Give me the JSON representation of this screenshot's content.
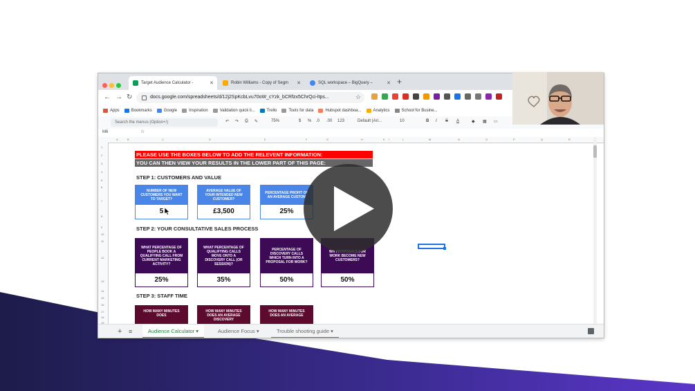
{
  "browser": {
    "tabs": [
      {
        "title": "Target Audience Calculator - ",
        "close": "✕"
      },
      {
        "title": "Robin Williams - Copy of Segm",
        "close": "✕"
      },
      {
        "title": "SQL workspace – BigQuery – ",
        "close": "✕"
      }
    ],
    "new_tab": "+",
    "url": "docs.google.com/spreadsheets/d/12j2SpKcbLvu70oW_cYzk_bCRfzx5ChrQci-ltps...",
    "bookmarks": [
      "Apps",
      "Bookmarks",
      "Google",
      "Inspiration",
      "Validation quick li...",
      "Trello",
      "Tools for data",
      "Hubspot dashboa...",
      "Analytics",
      "School for Busine..."
    ]
  },
  "toolbar": {
    "search_placeholder": "Search the menus (Option+/)",
    "zoom": "75%",
    "currency": "$",
    "percent": "%",
    "dec_dec": ".0",
    "dec_inc": ".00",
    "number_format": "123",
    "font": "Default (Ari...",
    "font_size": "10",
    "bold": "B",
    "italic": "I",
    "strike": "S",
    "text_color": "A"
  },
  "formula_bar": {
    "cell_ref": "M6",
    "fx": "fx"
  },
  "columns": [
    "A",
    "B",
    "C",
    "D",
    "E",
    "F",
    "G",
    "H",
    "I",
    "J",
    "K",
    "L",
    "M",
    "N",
    "O",
    "P",
    "Q",
    "R"
  ],
  "rows": [
    "1",
    "2",
    "3",
    "4",
    "5",
    "6",
    "7",
    "8",
    "9",
    "10",
    "11",
    "12",
    "13",
    "14",
    "15",
    "16",
    "17",
    "18",
    "19",
    "20"
  ],
  "sheet": {
    "banner1": "PLEASE USE THE BOXES BELOW TO ADD THE RELEVENT INFORMATION:",
    "banner2": "YOU CAN THEN VIEW YOUR RESULTS IN THE LOWER PART OF THIS PAGE:",
    "step1": "STEP 1: CUSTOMERS AND VALUE",
    "step1_boxes": [
      {
        "question": "NUMBER OF NEW CUSTOMERS YOU WANT TO TARGET?",
        "value": "5"
      },
      {
        "question": "AVERAGE VALUE OF YOUR INTENDED NEW CUSTOMER?",
        "value": "£3,500"
      },
      {
        "question": "PERCENTAGE PROFIT OF AN AVERAGE CUSTOM",
        "value": "25%"
      }
    ],
    "step2": "STEP 2: YOUR CONSULTATIVE SALES PROCESS",
    "step2_boxes": [
      {
        "question": "WHAT PERCENTAGE OF PEOPLE BOOK A QUALIFYING CALL FROM CURRENT MARKETING ACTIVITY?",
        "value": "25%"
      },
      {
        "question": "WHAT PERCENTAGE OF QUALIFYING CALLS MOVE ONTO A DISCOVERY CALL (OR SESSION)?",
        "value": "35%"
      },
      {
        "question": "PERCENTAGE OF DISCOVERY CALLS WHICH TURN INTO A PROPOSAL FOR WORK?",
        "value": "50%"
      },
      {
        "question": "WH                  PROPOSALS FOR WORK BECOME NEW CUSTOMERS?",
        "value": "50%"
      }
    ],
    "step3": "STEP 3: STAFF TIME",
    "step3_boxes": [
      {
        "question": "HOW MANY MINUTES DOES"
      },
      {
        "question": "HOW MANY MINUTES DOES AN AVERAGE DISCOVERY"
      },
      {
        "question": "HOW MANY MINUTES DOES AN AVERAGE"
      }
    ]
  },
  "sheet_tabs": {
    "add": "+",
    "list": "≡",
    "tabs": [
      "Audience Calculator",
      "Audience Focus",
      "Trouble shooting guide"
    ],
    "caret": "▾"
  },
  "colors": {
    "red_banner": "#ff0000",
    "grey_banner": "#666666",
    "blue_box": "#4a86e8",
    "purple_box": "#3d0b55",
    "maroon_box": "#5c0a2e",
    "sheets_green": "#188038",
    "bg_purple": "#4a2aa8",
    "bg_navy": "#1d1c4a"
  }
}
